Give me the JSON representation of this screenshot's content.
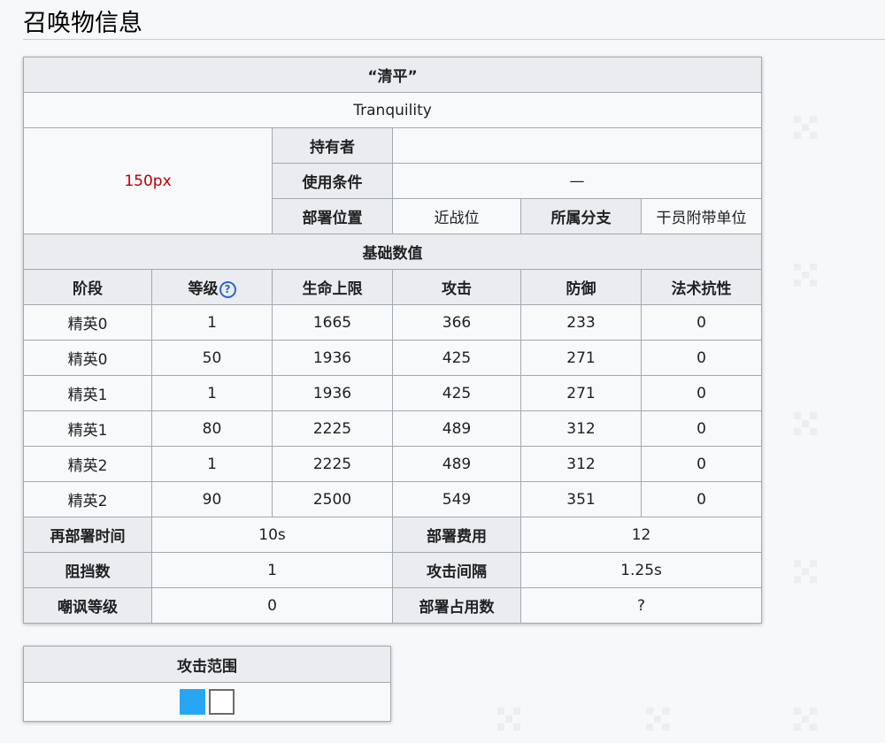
{
  "section_title": "召唤物信息",
  "name_quoted": "“清平”",
  "name_en": "Tranquility",
  "image_placeholder": "150px",
  "owner_label": "持有者",
  "owner_value": "",
  "condition_label": "使用条件",
  "condition_value": "—",
  "position_label": "部署位置",
  "position_value": "近战位",
  "branch_label": "所属分支",
  "branch_value": "干员附带单位",
  "base_stats_label": "基础数值",
  "stats_headers": [
    "阶段",
    "等级",
    "生命上限",
    "攻击",
    "防御",
    "法术抗性"
  ],
  "level_help_icon": "question-circle-icon",
  "stats_rows": [
    [
      "精英0",
      "1",
      "1665",
      "366",
      "233",
      "0"
    ],
    [
      "精英0",
      "50",
      "1936",
      "425",
      "271",
      "0"
    ],
    [
      "精英1",
      "1",
      "1936",
      "425",
      "271",
      "0"
    ],
    [
      "精英1",
      "80",
      "2225",
      "489",
      "312",
      "0"
    ],
    [
      "精英2",
      "1",
      "2225",
      "489",
      "312",
      "0"
    ],
    [
      "精英2",
      "90",
      "2500",
      "549",
      "351",
      "0"
    ]
  ],
  "extra": [
    {
      "label_a": "再部署时间",
      "value_a": "10s",
      "label_b": "部署费用",
      "value_b": "12"
    },
    {
      "label_a": "阻挡数",
      "value_a": "1",
      "label_b": "攻击间隔",
      "value_b": "1.25s"
    },
    {
      "label_a": "嘲讽等级",
      "value_a": "0",
      "label_b": "部署占用数",
      "value_b": "?"
    }
  ],
  "range_title": "攻击范围",
  "range_cells": [
    "filled",
    "empty"
  ],
  "colors": {
    "filled": "#27a6f3",
    "header_bg": "#eaecf0",
    "border": "#a2a9b1",
    "link_red": "#ba0000"
  }
}
